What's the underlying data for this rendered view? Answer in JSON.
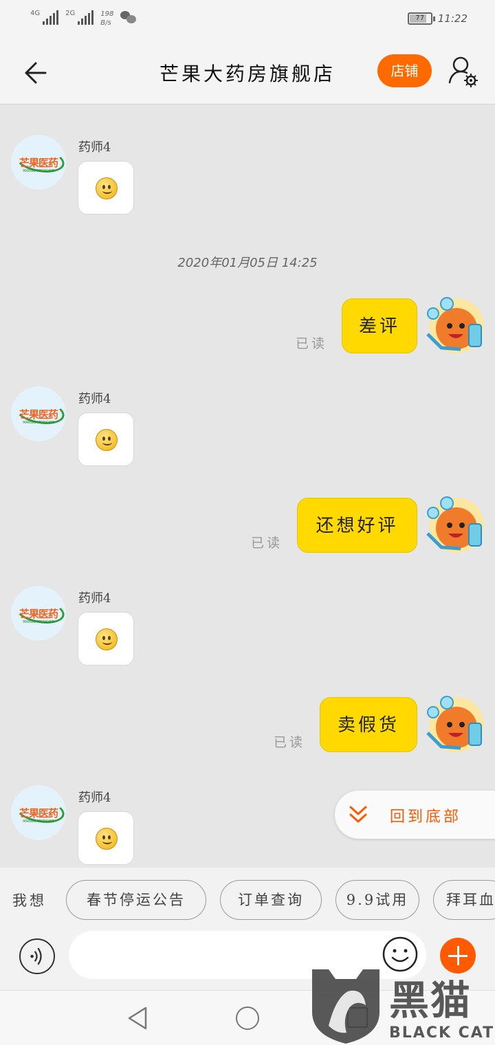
{
  "status_bar": {
    "signal_1": "4G",
    "signal_2": "2G",
    "speed_value": "198",
    "speed_unit": "B/s",
    "wechat_icon": "wechat-icon",
    "battery": "77",
    "time": "11:22"
  },
  "header": {
    "title": "芒果大药房旗舰店",
    "shop_button": "店铺",
    "back_icon": "arrow-left-icon",
    "settings_icon": "user-settings-icon"
  },
  "shop_logo": {
    "text": "芒果医药",
    "sub": "MANGO MEDICINE"
  },
  "messages": [
    {
      "direction": "in",
      "sender": "药师4",
      "content": "smiley-emoji"
    },
    {
      "type": "timestamp",
      "text": "2020年01月05日  14:25"
    },
    {
      "direction": "out",
      "text": "差评",
      "status": "已读"
    },
    {
      "direction": "in",
      "sender": "药师4",
      "content": "smiley-emoji"
    },
    {
      "direction": "out",
      "text": "还想好评",
      "status": "已读"
    },
    {
      "direction": "in",
      "sender": "药师4",
      "content": "smiley-emoji"
    },
    {
      "direction": "out",
      "text": "卖假货",
      "status": "已读"
    },
    {
      "direction": "in",
      "sender": "药师4",
      "content": "smiley-emoji"
    }
  ],
  "scroll_to_bottom": {
    "label": "回到底部",
    "icon": "double-chevron-down-icon"
  },
  "quick_replies": {
    "label": "我想",
    "chips": [
      "春节停运公告",
      "订单查询",
      "9.9试用",
      "拜耳血"
    ]
  },
  "composer": {
    "voice_icon": "voice-icon",
    "placeholder": "",
    "emoji_icon": "emoji-icon",
    "plus_icon": "plus-icon"
  },
  "system_nav": {
    "back": "triangle-back-icon",
    "home": "circle-home-icon",
    "recent": "square-recent-icon"
  },
  "watermark": {
    "cn": "黑猫",
    "en": "BLACK CAT"
  },
  "colors": {
    "accent": "#ff6a00",
    "out_bubble": "#ffd900",
    "chat_bg": "#e6e6e6"
  }
}
